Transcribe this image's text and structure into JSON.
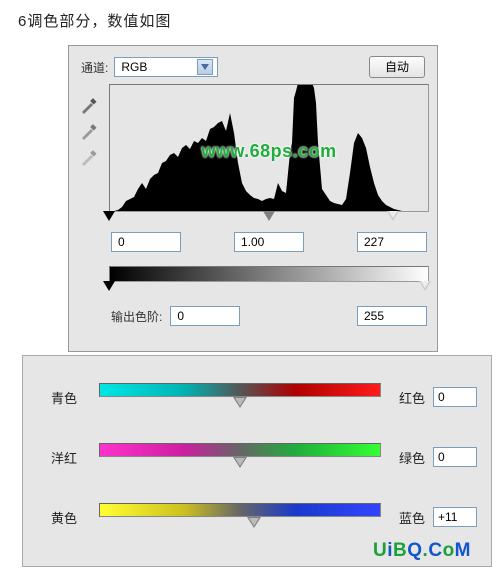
{
  "caption": "6调色部分，数值如图",
  "levels": {
    "channel_label": "通道:",
    "channel_value": "RGB",
    "auto_label": "自动",
    "input_black": "0",
    "input_mid": "1.00",
    "input_white": "227",
    "output_label": "输出色阶:",
    "output_black": "0",
    "output_white": "255",
    "watermark": "www.68ps.com"
  },
  "color_balance": {
    "rows": [
      {
        "left": "青色",
        "right": "红色",
        "value": "0",
        "slider_pct": 50
      },
      {
        "left": "洋红",
        "right": "绿色",
        "value": "0",
        "slider_pct": 50
      },
      {
        "left": "黄色",
        "right": "蓝色",
        "value": "+11",
        "slider_pct": 55
      }
    ],
    "gradients": [
      "linear-gradient(to right,#00e6e6,#00b3b3 30%,#555 50%,#b00000 70%,#ff1a1a)",
      "linear-gradient(to right,#ff33cc,#cc1fa0 30%,#666 50%,#1fae3c 70%,#33ff33)",
      "linear-gradient(to right,#ffff33,#ccc020 30%,#666 50%,#1a3acc 70%,#3344ff)"
    ]
  },
  "watermark_uibq": "UiBQ.CoM"
}
